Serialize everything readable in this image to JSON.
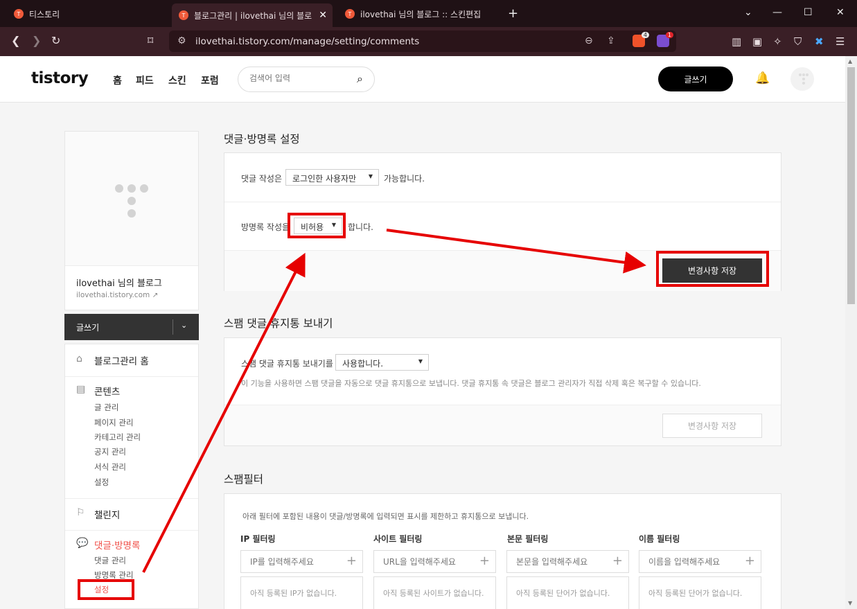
{
  "browser": {
    "tabs": [
      {
        "title": "티스토리"
      },
      {
        "title": "블로그관리 | ilovethai 님의 블로"
      },
      {
        "title": "ilovethai 님의 블로그 :: 스킨편집"
      }
    ],
    "url": "ilovethai.tistory.com/manage/setting/comments",
    "shield_count": "4",
    "alert_count": "1"
  },
  "header": {
    "logo": "tistory",
    "nav": [
      "홈",
      "피드",
      "스킨",
      "포럼"
    ],
    "search_placeholder": "검색어 입력",
    "write_label": "글쓰기"
  },
  "sidebar": {
    "blog_name": "ilovethai 님의 블로그",
    "blog_url": "ilovethai.tistory.com",
    "write_label": "글쓰기",
    "home": "블로그관리 홈",
    "contents": {
      "title": "콘텐츠",
      "items": [
        "글 관리",
        "페이지 관리",
        "카테고리 관리",
        "공지 관리",
        "서식 관리",
        "설정"
      ]
    },
    "challenge": "챌린지",
    "comments": {
      "title": "댓글·방명록",
      "items": [
        "댓글 관리",
        "방명록 관리",
        "설정"
      ]
    }
  },
  "settings": {
    "title": "댓글·방명록 설정",
    "comment_prefix": "댓글 작성은",
    "comment_value": "로그인한 사용자만",
    "comment_suffix": "가능합니다.",
    "guestbook_prefix": "방명록 작성을",
    "guestbook_value": "비허용",
    "guestbook_suffix": "합니다.",
    "save": "변경사항 저장"
  },
  "spam_trash": {
    "title": "스팸 댓글 휴지통 보내기",
    "label": "스팸 댓글 휴지통 보내기를",
    "value": "사용합니다.",
    "description": "이 기능을 사용하면 스팸 댓글을 자동으로 댓글 휴지통으로 보냅니다. 댓글 휴지통 속 댓글은 블로그 관리자가 직접 삭제 혹은 복구할 수 있습니다.",
    "save": "변경사항 저장"
  },
  "spam_filter": {
    "title": "스팸필터",
    "description": "아래 필터에 포함된 내용이 댓글/방명록에 입력되면 표시를 제한하고 휴지통으로 보냅니다.",
    "filters": [
      {
        "label": "IP 필터링",
        "placeholder": "IP를 입력해주세요",
        "empty": "아직 등록된 IP가 없습니다."
      },
      {
        "label": "사이트 필터링",
        "placeholder": "URL을 입력해주세요",
        "empty": "아직 등록된 사이트가 없습니다."
      },
      {
        "label": "본문 필터링",
        "placeholder": "본문을 입력해주세요",
        "empty": "아직 등록된 단어가 없습니다."
      },
      {
        "label": "이름 필터링",
        "placeholder": "이름을 입력해주세요",
        "empty": "아직 등록된 단어가 없습니다."
      }
    ]
  },
  "colors": {
    "accent_red": "#e60000",
    "dark_button": "#333333",
    "menu_active": "#f0514a"
  }
}
